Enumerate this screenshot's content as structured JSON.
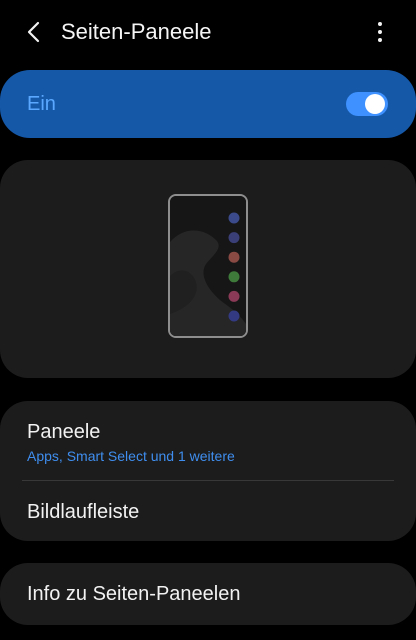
{
  "header": {
    "title": "Seiten-Paneele",
    "back_icon": "chevron-left-icon",
    "more_icon": "more-vertical-icon"
  },
  "master_switch": {
    "label": "Ein",
    "state": "on",
    "accent_color": "#3e91ff",
    "card_color": "#1558a8"
  },
  "preview": {
    "handle_dots": [
      "#3a4a8a",
      "#3b3f78",
      "#8a4a44",
      "#3e7a3a",
      "#8a3a56",
      "#333a82"
    ]
  },
  "settings": {
    "paneele": {
      "title": "Paneele",
      "subtitle": "Apps, Smart Select und 1 weitere"
    },
    "bildlaufleiste": {
      "title": "Bildlaufleiste"
    }
  },
  "info": {
    "title": "Info zu Seiten-Paneelen"
  }
}
